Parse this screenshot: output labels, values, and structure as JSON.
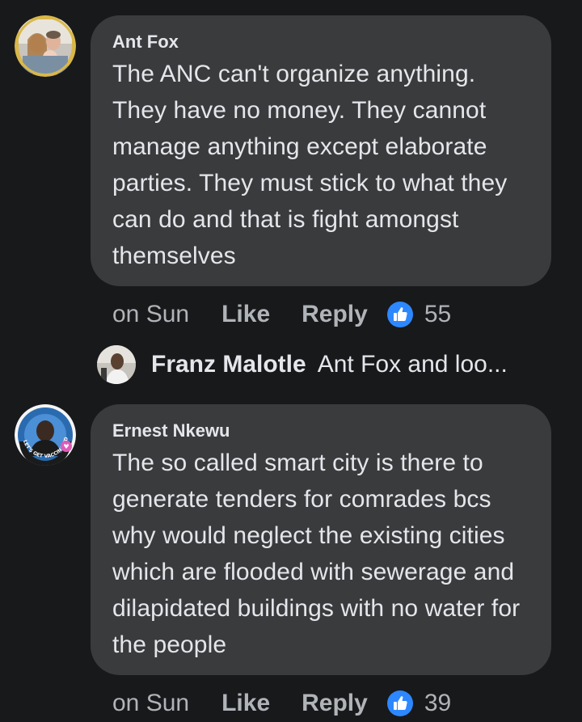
{
  "comments": [
    {
      "author": "Ant Fox",
      "text": "The ANC can't organize anything. They have no money. They cannot manage anything except elaborate parties. They must stick to what they can do and that is fight amongst themselves",
      "time": "on Sun",
      "like_label": "Like",
      "reply_label": "Reply",
      "reaction_icon": "thumbs-up-icon",
      "reaction_count": "55",
      "reply_preview": {
        "author": "Franz Malotle",
        "text": "Ant Fox and loo..."
      }
    },
    {
      "author": "Ernest Nkewu",
      "text": "The so called smart city is there to generate tenders for comrades bcs why would neglect the existing cities which are flooded with sewerage and dilapidated buildings with no water for the people",
      "time": "on Sun",
      "like_label": "Like",
      "reply_label": "Reply",
      "reaction_icon": "thumbs-up-icon",
      "reaction_count": "39",
      "avatar_badge_text": "LET'S GET VACCINATED"
    }
  ],
  "colors": {
    "background": "#18191a",
    "bubble": "#3a3b3c",
    "primary_text": "#e4e6eb",
    "secondary_text": "#b0b3b8",
    "like_blue": "#2d88ff"
  }
}
